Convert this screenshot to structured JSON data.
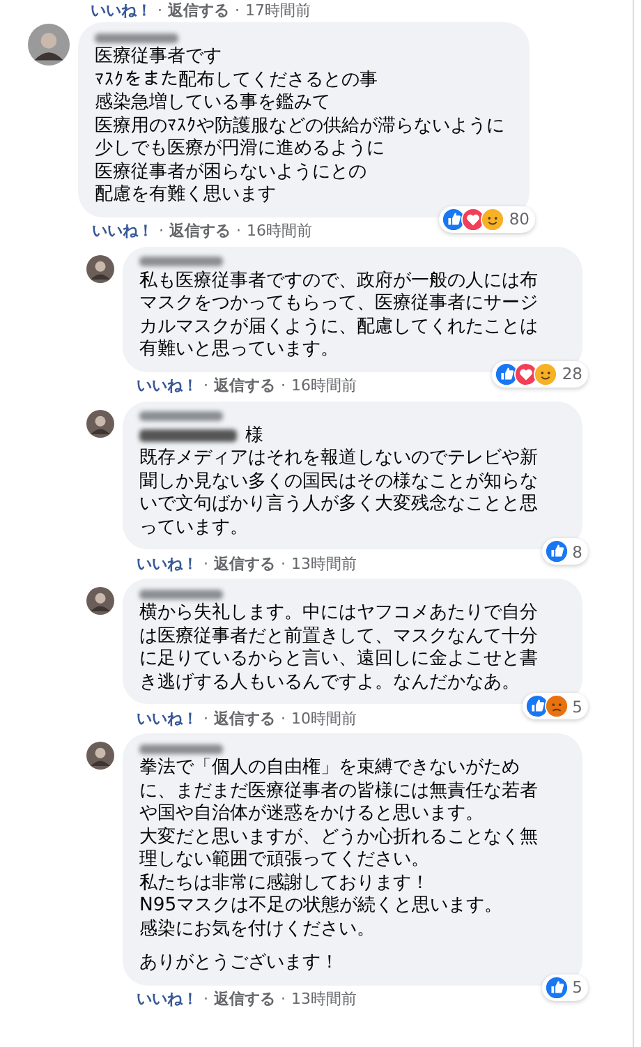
{
  "top_actions": {
    "like": "いいね！",
    "separator": "·",
    "reply": "返信する",
    "separator_2": "·",
    "time": "17時間前"
  },
  "comments": [
    {
      "kind": "top",
      "lines": [
        "医療従事者です",
        "ﾏｽｸをまた配布してくださるとの事",
        "感染急増している事を鑑みて",
        "医療用のﾏｽｸや防護服などの供給が滞らないように",
        "少しでも医療が円滑に進めるように",
        "医療従事者が困らないようにとの",
        "配慮を有難く思います"
      ],
      "reactions": [
        {
          "kind": "like"
        },
        {
          "kind": "love"
        },
        {
          "kind": "care"
        }
      ],
      "count": "80",
      "like": "いいね！",
      "separator": "·",
      "reply": "返信する",
      "separator_2": "·",
      "time": "16時間前"
    },
    {
      "kind": "reply",
      "lines": [
        "私も医療従事者ですので、政府が一般の人には布",
        "マスクをつかってもらって、医療従事者にサージ",
        "カルマスクが届くように、配慮してくれたことは",
        "有難いと思っています。"
      ],
      "reactions": [
        {
          "kind": "like"
        },
        {
          "kind": "love"
        },
        {
          "kind": "care"
        }
      ],
      "count": "28",
      "like": "いいね！",
      "separator": "·",
      "reply": "返信する",
      "separator_2": "·",
      "time": "16時間前"
    },
    {
      "kind": "reply",
      "mention_suffix": "様",
      "lines": [
        "既存メディアはそれを報道しないのでテレビや新",
        "聞しか見ない多くの国民はその様なことが知らな",
        "いで文句ばかり言う人が多く大変残念なことと思",
        "っています。"
      ],
      "reactions": [
        {
          "kind": "like"
        }
      ],
      "count": "8",
      "like": "いいね！",
      "separator": "·",
      "reply": "返信する",
      "separator_2": "·",
      "time": "13時間前"
    },
    {
      "kind": "reply",
      "lines": [
        "横から失礼します。中にはヤフコメあたりで自分",
        "は医療従事者だと前置きして、マスクなんて十分",
        "に足りているからと言い、遠回しに金よこせと書",
        "き逃げする人もいるんですよ。なんだかなあ。"
      ],
      "reactions": [
        {
          "kind": "like"
        },
        {
          "kind": "angry"
        }
      ],
      "count": "5",
      "like": "いいね！",
      "separator": "·",
      "reply": "返信する",
      "separator_2": "·",
      "time": "10時間前"
    },
    {
      "kind": "reply",
      "lines": [
        "拳法で「個人の自由権」を束縛できないがため",
        "に、まだまだ医療従事者の皆様には無責任な若者",
        "や国や自治体が迷惑をかけると思います。",
        "大変だと思いますが、どうか心折れることなく無",
        "理しない範囲で頑張ってください。",
        "私たちは非常に感謝しております！",
        "N95マスクは不足の状態が続くと思います。",
        "感染にお気を付けください。"
      ],
      "closing": "ありがとうございます！",
      "reactions": [
        {
          "kind": "like"
        }
      ],
      "count": "5",
      "like": "いいね！",
      "separator": "·",
      "reply": "返信する",
      "separator_2": "·",
      "time": "13時間前"
    }
  ]
}
